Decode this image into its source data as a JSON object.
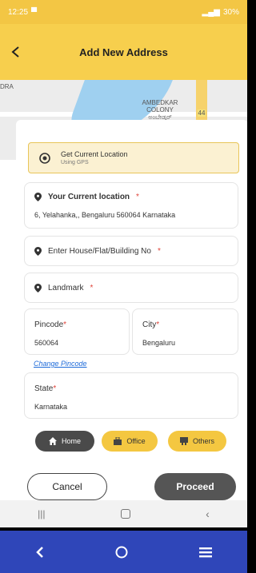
{
  "status": {
    "time": "12:25",
    "battery": "30%"
  },
  "header": {
    "title": "Add New Address"
  },
  "map": {
    "labels": {
      "area": "AMBEDKAR\nCOLONY\nಅಂಬೇಡ್ಕರ್\nಕಾಲೊನಿ",
      "road": "44",
      "left": "DRA"
    }
  },
  "gps": {
    "title": "Get Current Location",
    "subtitle": "Using GPS"
  },
  "current_location": {
    "label": "Your Current location",
    "value": "6, Yelahanka,, Bengaluru  560064 Karnataka"
  },
  "house": {
    "placeholder": "Enter House/Flat/Building No"
  },
  "landmark": {
    "placeholder": "Landmark"
  },
  "pincode": {
    "label": "Pincode",
    "value": "560064"
  },
  "city": {
    "label": "City",
    "value": "Bengaluru"
  },
  "change_pincode": "Change Pincode",
  "state": {
    "label": "State",
    "value": "Karnataka"
  },
  "chips": {
    "home": "Home",
    "office": "Office",
    "others": "Others"
  },
  "actions": {
    "cancel": "Cancel",
    "proceed": "Proceed"
  },
  "required_mark": "*"
}
